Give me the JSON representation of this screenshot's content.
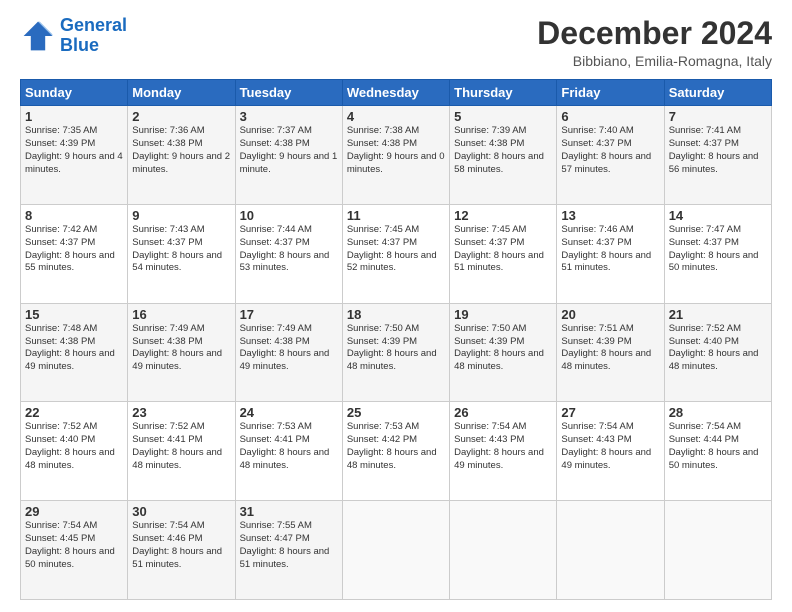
{
  "logo": {
    "line1": "General",
    "line2": "Blue"
  },
  "header": {
    "title": "December 2024",
    "subtitle": "Bibbiano, Emilia-Romagna, Italy"
  },
  "weekdays": [
    "Sunday",
    "Monday",
    "Tuesday",
    "Wednesday",
    "Thursday",
    "Friday",
    "Saturday"
  ],
  "weeks": [
    [
      {
        "day": "1",
        "sunrise": "Sunrise: 7:35 AM",
        "sunset": "Sunset: 4:39 PM",
        "daylight": "Daylight: 9 hours and 4 minutes."
      },
      {
        "day": "2",
        "sunrise": "Sunrise: 7:36 AM",
        "sunset": "Sunset: 4:38 PM",
        "daylight": "Daylight: 9 hours and 2 minutes."
      },
      {
        "day": "3",
        "sunrise": "Sunrise: 7:37 AM",
        "sunset": "Sunset: 4:38 PM",
        "daylight": "Daylight: 9 hours and 1 minute."
      },
      {
        "day": "4",
        "sunrise": "Sunrise: 7:38 AM",
        "sunset": "Sunset: 4:38 PM",
        "daylight": "Daylight: 9 hours and 0 minutes."
      },
      {
        "day": "5",
        "sunrise": "Sunrise: 7:39 AM",
        "sunset": "Sunset: 4:38 PM",
        "daylight": "Daylight: 8 hours and 58 minutes."
      },
      {
        "day": "6",
        "sunrise": "Sunrise: 7:40 AM",
        "sunset": "Sunset: 4:37 PM",
        "daylight": "Daylight: 8 hours and 57 minutes."
      },
      {
        "day": "7",
        "sunrise": "Sunrise: 7:41 AM",
        "sunset": "Sunset: 4:37 PM",
        "daylight": "Daylight: 8 hours and 56 minutes."
      }
    ],
    [
      {
        "day": "8",
        "sunrise": "Sunrise: 7:42 AM",
        "sunset": "Sunset: 4:37 PM",
        "daylight": "Daylight: 8 hours and 55 minutes."
      },
      {
        "day": "9",
        "sunrise": "Sunrise: 7:43 AM",
        "sunset": "Sunset: 4:37 PM",
        "daylight": "Daylight: 8 hours and 54 minutes."
      },
      {
        "day": "10",
        "sunrise": "Sunrise: 7:44 AM",
        "sunset": "Sunset: 4:37 PM",
        "daylight": "Daylight: 8 hours and 53 minutes."
      },
      {
        "day": "11",
        "sunrise": "Sunrise: 7:45 AM",
        "sunset": "Sunset: 4:37 PM",
        "daylight": "Daylight: 8 hours and 52 minutes."
      },
      {
        "day": "12",
        "sunrise": "Sunrise: 7:45 AM",
        "sunset": "Sunset: 4:37 PM",
        "daylight": "Daylight: 8 hours and 51 minutes."
      },
      {
        "day": "13",
        "sunrise": "Sunrise: 7:46 AM",
        "sunset": "Sunset: 4:37 PM",
        "daylight": "Daylight: 8 hours and 51 minutes."
      },
      {
        "day": "14",
        "sunrise": "Sunrise: 7:47 AM",
        "sunset": "Sunset: 4:37 PM",
        "daylight": "Daylight: 8 hours and 50 minutes."
      }
    ],
    [
      {
        "day": "15",
        "sunrise": "Sunrise: 7:48 AM",
        "sunset": "Sunset: 4:38 PM",
        "daylight": "Daylight: 8 hours and 49 minutes."
      },
      {
        "day": "16",
        "sunrise": "Sunrise: 7:49 AM",
        "sunset": "Sunset: 4:38 PM",
        "daylight": "Daylight: 8 hours and 49 minutes."
      },
      {
        "day": "17",
        "sunrise": "Sunrise: 7:49 AM",
        "sunset": "Sunset: 4:38 PM",
        "daylight": "Daylight: 8 hours and 49 minutes."
      },
      {
        "day": "18",
        "sunrise": "Sunrise: 7:50 AM",
        "sunset": "Sunset: 4:39 PM",
        "daylight": "Daylight: 8 hours and 48 minutes."
      },
      {
        "day": "19",
        "sunrise": "Sunrise: 7:50 AM",
        "sunset": "Sunset: 4:39 PM",
        "daylight": "Daylight: 8 hours and 48 minutes."
      },
      {
        "day": "20",
        "sunrise": "Sunrise: 7:51 AM",
        "sunset": "Sunset: 4:39 PM",
        "daylight": "Daylight: 8 hours and 48 minutes."
      },
      {
        "day": "21",
        "sunrise": "Sunrise: 7:52 AM",
        "sunset": "Sunset: 4:40 PM",
        "daylight": "Daylight: 8 hours and 48 minutes."
      }
    ],
    [
      {
        "day": "22",
        "sunrise": "Sunrise: 7:52 AM",
        "sunset": "Sunset: 4:40 PM",
        "daylight": "Daylight: 8 hours and 48 minutes."
      },
      {
        "day": "23",
        "sunrise": "Sunrise: 7:52 AM",
        "sunset": "Sunset: 4:41 PM",
        "daylight": "Daylight: 8 hours and 48 minutes."
      },
      {
        "day": "24",
        "sunrise": "Sunrise: 7:53 AM",
        "sunset": "Sunset: 4:41 PM",
        "daylight": "Daylight: 8 hours and 48 minutes."
      },
      {
        "day": "25",
        "sunrise": "Sunrise: 7:53 AM",
        "sunset": "Sunset: 4:42 PM",
        "daylight": "Daylight: 8 hours and 48 minutes."
      },
      {
        "day": "26",
        "sunrise": "Sunrise: 7:54 AM",
        "sunset": "Sunset: 4:43 PM",
        "daylight": "Daylight: 8 hours and 49 minutes."
      },
      {
        "day": "27",
        "sunrise": "Sunrise: 7:54 AM",
        "sunset": "Sunset: 4:43 PM",
        "daylight": "Daylight: 8 hours and 49 minutes."
      },
      {
        "day": "28",
        "sunrise": "Sunrise: 7:54 AM",
        "sunset": "Sunset: 4:44 PM",
        "daylight": "Daylight: 8 hours and 50 minutes."
      }
    ],
    [
      {
        "day": "29",
        "sunrise": "Sunrise: 7:54 AM",
        "sunset": "Sunset: 4:45 PM",
        "daylight": "Daylight: 8 hours and 50 minutes."
      },
      {
        "day": "30",
        "sunrise": "Sunrise: 7:54 AM",
        "sunset": "Sunset: 4:46 PM",
        "daylight": "Daylight: 8 hours and 51 minutes."
      },
      {
        "day": "31",
        "sunrise": "Sunrise: 7:55 AM",
        "sunset": "Sunset: 4:47 PM",
        "daylight": "Daylight: 8 hours and 51 minutes."
      },
      null,
      null,
      null,
      null
    ]
  ]
}
